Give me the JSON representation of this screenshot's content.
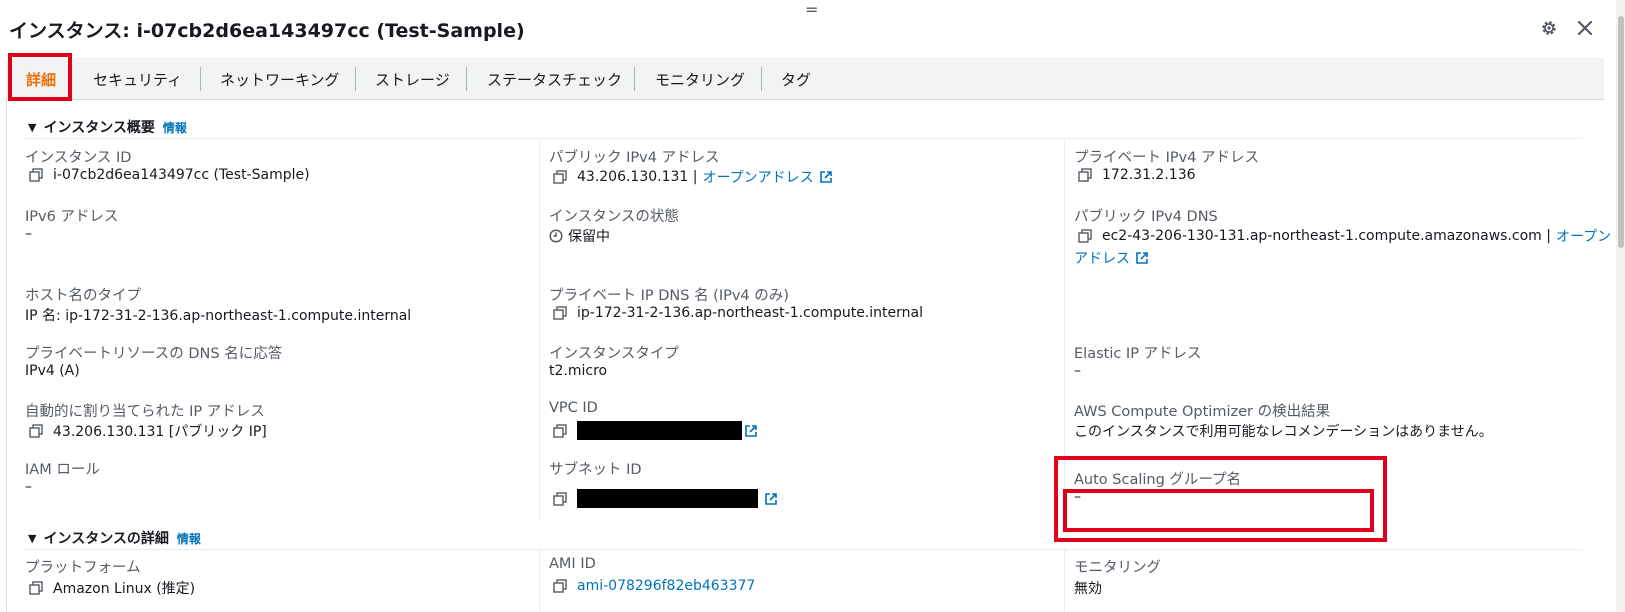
{
  "header": {
    "title": "インスタンス: i-07cb2d6ea143497cc (Test-Sample)",
    "drag_handle": "=",
    "settings_icon": "gear-icon",
    "close_icon": "close-icon"
  },
  "tabs": [
    {
      "label": "詳細",
      "active": true
    },
    {
      "label": "セキュリティ",
      "active": false
    },
    {
      "label": "ネットワーキング",
      "active": false
    },
    {
      "label": "ストレージ",
      "active": false
    },
    {
      "label": "ステータスチェック",
      "active": false
    },
    {
      "label": "モニタリング",
      "active": false
    },
    {
      "label": "タグ",
      "active": false
    }
  ],
  "sections": {
    "summary": {
      "caret": "▼",
      "title": "インスタンス概要",
      "info": "情報"
    },
    "details": {
      "caret": "▼",
      "title": "インスタンスの詳細",
      "info": "情報"
    }
  },
  "fields": {
    "instance_id": {
      "label": "インスタンス ID",
      "value": "i-07cb2d6ea143497cc (Test-Sample)"
    },
    "public_ipv4": {
      "label": "パブリック IPv4 アドレス",
      "value": "43.206.130.131 |",
      "link": "オープンアドレス"
    },
    "private_ipv4": {
      "label": "プライベート IPv4 アドレス",
      "value": "172.31.2.136"
    },
    "ipv6": {
      "label": "IPv6 アドレス",
      "value": "–"
    },
    "instance_state": {
      "label": "インスタンスの状態",
      "value": "保留中"
    },
    "public_dns": {
      "label": "パブリック IPv4 DNS",
      "value": "ec2-43-206-130-131.ap-northeast-1.compute.amazonaws.com |",
      "link1": "オープン",
      "link2": "アドレス"
    },
    "hostname_type": {
      "label": "ホスト名のタイプ",
      "value": "IP 名: ip-172-31-2-136.ap-northeast-1.compute.internal"
    },
    "private_dns": {
      "label": "プライベート IP DNS 名 (IPv4 のみ)",
      "value": "ip-172-31-2-136.ap-northeast-1.compute.internal"
    },
    "resource_dns": {
      "label": "プライベートリソースの DNS 名に応答",
      "value": "IPv4 (A)"
    },
    "instance_type": {
      "label": "インスタンスタイプ",
      "value": "t2.micro"
    },
    "elastic_ip": {
      "label": "Elastic IP アドレス",
      "value": "–"
    },
    "auto_ip": {
      "label": "自動的に割り当てられた IP アドレス",
      "value": "43.206.130.131 [パブリック IP]"
    },
    "vpc_id": {
      "label": "VPC ID"
    },
    "optimizer": {
      "label": "AWS Compute Optimizer の検出結果",
      "value": "このインスタンスで利用可能なレコメンデーションはありません。"
    },
    "iam_role": {
      "label": "IAM ロール",
      "value": "–"
    },
    "subnet_id": {
      "label": "サブネット ID"
    },
    "asg_name": {
      "label": "Auto Scaling グループ名",
      "value": "–"
    },
    "platform": {
      "label": "プラットフォーム",
      "value": "Amazon Linux (推定)"
    },
    "ami_id": {
      "label": "AMI ID",
      "value": "ami-078296f82eb463377"
    },
    "monitoring": {
      "label": "モニタリング",
      "value": "無効"
    }
  },
  "colors": {
    "accent": "#ec7211",
    "link": "#0073bb",
    "highlight": "#e0001b",
    "redaction": "#000000"
  }
}
